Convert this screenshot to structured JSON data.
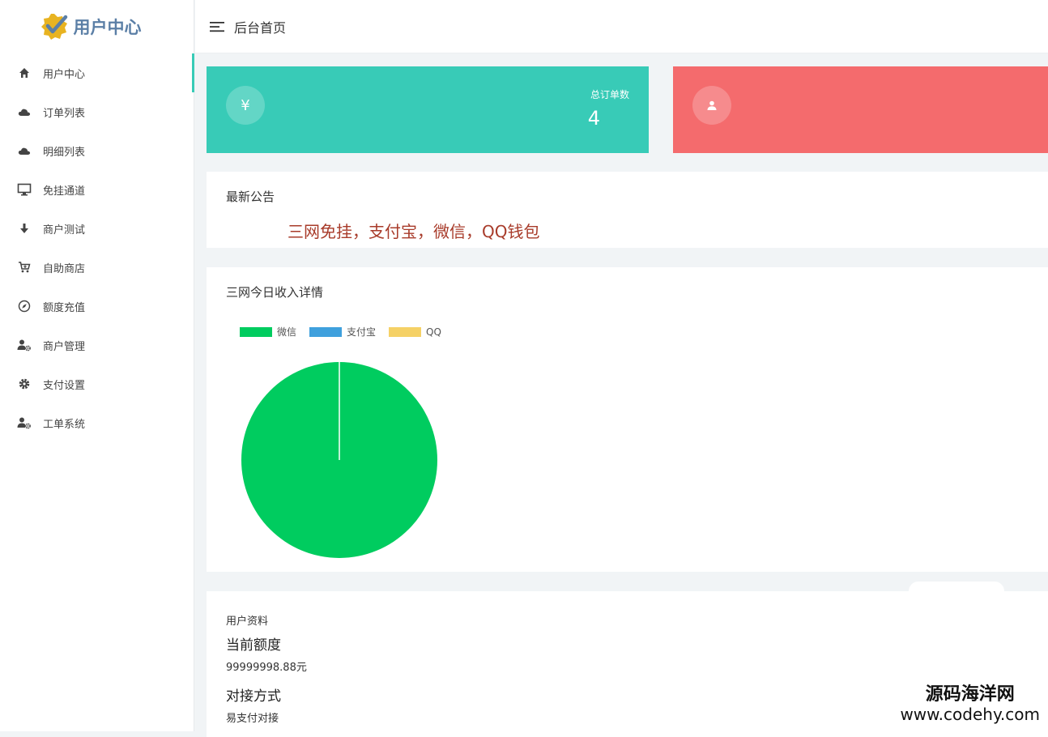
{
  "brand": {
    "title": "用户中心",
    "accent": "#5b7fa6"
  },
  "sidebar": {
    "items": [
      {
        "label": "用户中心",
        "icon": "home-icon"
      },
      {
        "label": "订单列表",
        "icon": "cloud-icon"
      },
      {
        "label": "明细列表",
        "icon": "cloud-icon"
      },
      {
        "label": "免挂通道",
        "icon": "monitor-icon"
      },
      {
        "label": "商户测试",
        "icon": "arrow-down-icon"
      },
      {
        "label": "自助商店",
        "icon": "cart-icon"
      },
      {
        "label": "额度充值",
        "icon": "compass-icon"
      },
      {
        "label": "商户管理",
        "icon": "user-gear-icon"
      },
      {
        "label": "支付设置",
        "icon": "gear-icon"
      },
      {
        "label": "工单系统",
        "icon": "user-gear-icon"
      }
    ],
    "active_index": 0
  },
  "topbar": {
    "breadcrumb": "后台首页",
    "menu_icon": "hamburger-icon"
  },
  "stats": [
    {
      "icon_glyph": "¥",
      "icon": "yen-icon",
      "label": "总订单数",
      "value": "4",
      "color": "#38cbb7"
    },
    {
      "icon": "user-icon",
      "color": "#f46b6d"
    }
  ],
  "notice": {
    "title": "最新公告",
    "text": "三网免挂，支付宝，微信，QQ钱包",
    "color": "#a83b2a"
  },
  "chart_panel": {
    "title": "三网今日收入详情"
  },
  "chart_data": {
    "type": "pie",
    "legend_position": "top-left",
    "series": [
      {
        "name": "微信",
        "value": 100,
        "color": "#00cc5f"
      },
      {
        "name": "支付宝",
        "value": 0,
        "color": "#3fa0dd"
      },
      {
        "name": "QQ",
        "value": 0,
        "color": "#f5d166"
      }
    ]
  },
  "user_info": {
    "section_title": "用户资料",
    "quota_label": "当前额度",
    "quota_value": "99999998.88元",
    "method_label": "对接方式",
    "method_value": "易支付对接"
  },
  "watermark": {
    "line1": "源码海洋网",
    "line2": "www.codehy.com"
  }
}
